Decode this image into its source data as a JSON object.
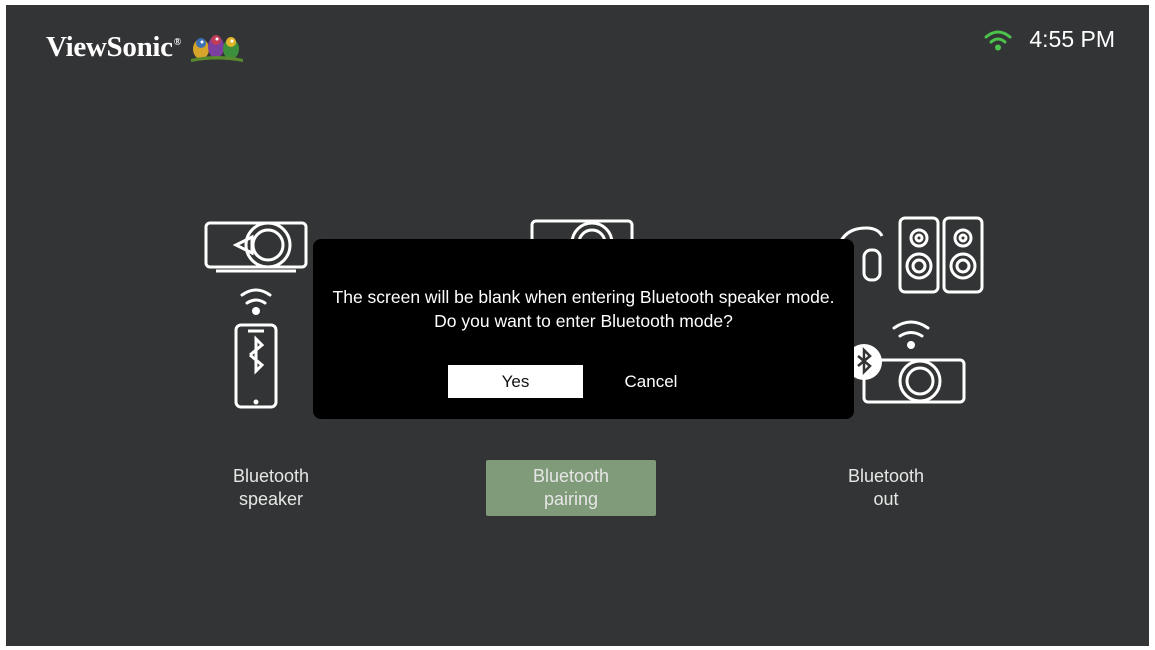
{
  "header": {
    "brand": "ViewSonic",
    "brand_mark": "®",
    "logo_icon": "birds-icon"
  },
  "status": {
    "time": "4:55 PM",
    "wifi_icon": "wifi-icon"
  },
  "options": [
    {
      "label": "Bluetooth\nspeaker",
      "selected": false
    },
    {
      "label": "Bluetooth\npairing",
      "selected": true
    },
    {
      "label": "Bluetooth\nout",
      "selected": false
    }
  ],
  "dialog": {
    "message": "The screen will be blank when entering Bluetooth speaker mode.\nDo you want to enter Bluetooth mode?",
    "yes_label": "Yes",
    "cancel_label": "Cancel"
  },
  "colors": {
    "background": "#333435",
    "selected": "#7f9b7a",
    "wifi_status": "#4cc44c",
    "dialog": "#000000"
  }
}
